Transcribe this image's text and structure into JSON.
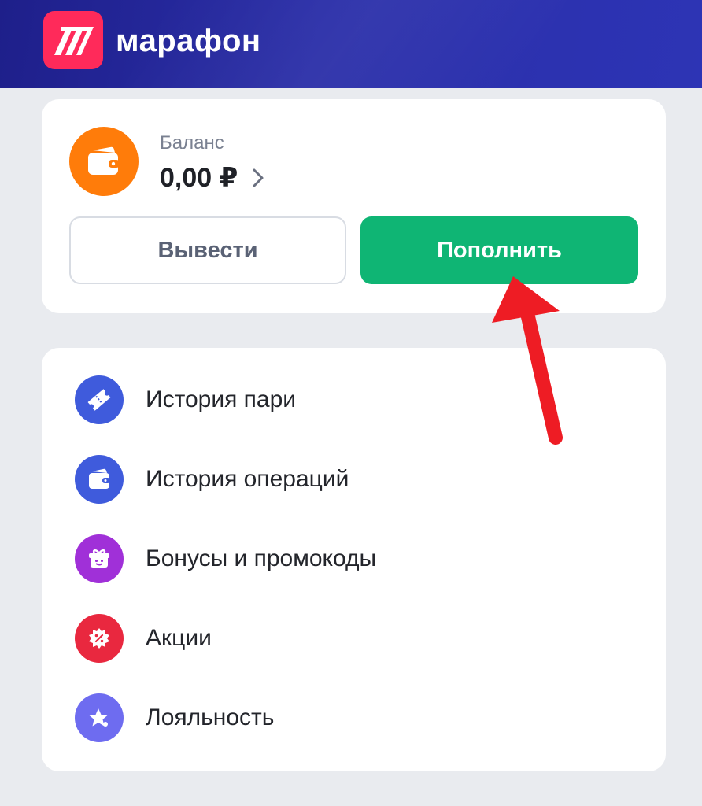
{
  "header": {
    "brand": "марафон",
    "logo_icon": "marathon-logo-icon",
    "logo_color": "#ff2a5a",
    "background": "#2a2ea8"
  },
  "balance": {
    "label": "Баланс",
    "amount": "0,00 ₽",
    "wallet_icon": "wallet-icon",
    "wallet_color": "#ff7c0a",
    "withdraw_label": "Вывести",
    "deposit_label": "Пополнить",
    "deposit_color": "#0fb574"
  },
  "menu": {
    "items": [
      {
        "label": "История пари",
        "icon": "ticket-icon",
        "color": "#3f5bdc"
      },
      {
        "label": "История операций",
        "icon": "wallet-icon",
        "color": "#3f5bdc"
      },
      {
        "label": "Бонусы и промокоды",
        "icon": "gift-icon",
        "color": "#a030d8"
      },
      {
        "label": "Акции",
        "icon": "discount-badge-icon",
        "color": "#e9283f"
      },
      {
        "label": "Лояльность",
        "icon": "star-icon",
        "color": "#6e6cf0"
      }
    ]
  },
  "annotation": {
    "arrow_color": "#ee1c24"
  }
}
